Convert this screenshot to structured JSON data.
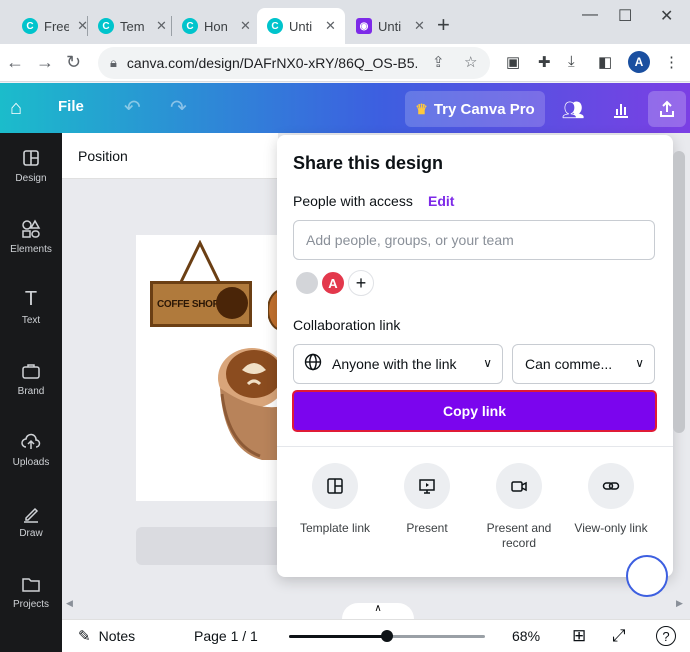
{
  "browser": {
    "tabs": [
      {
        "title": "Free",
        "active": false
      },
      {
        "title": "Tem",
        "active": false
      },
      {
        "title": "Hon",
        "active": false
      },
      {
        "title": "Unti",
        "active": true
      },
      {
        "title": "Unti",
        "active": false
      }
    ],
    "url": "canva.com/design/DAFrNX0-xRY/86Q_OS-B5...",
    "profile_initial": "A"
  },
  "header": {
    "file_label": "File",
    "pro_label": "Try Canva Pro"
  },
  "rail": {
    "items": [
      {
        "label": "Design",
        "icon": "layout-icon"
      },
      {
        "label": "Elements",
        "icon": "shapes-icon"
      },
      {
        "label": "Text",
        "icon": "text-icon"
      },
      {
        "label": "Brand",
        "icon": "brand-icon"
      },
      {
        "label": "Uploads",
        "icon": "upload-icon"
      },
      {
        "label": "Draw",
        "icon": "draw-icon"
      },
      {
        "label": "Projects",
        "icon": "folder-icon"
      }
    ]
  },
  "context": {
    "position_label": "Position"
  },
  "artwork": {
    "sign_text": "COFFE SHOP"
  },
  "share": {
    "title": "Share this design",
    "people_label": "People with access",
    "edit_label": "Edit",
    "input_placeholder": "Add people, groups, or your team",
    "avatar_initial": "A",
    "collab_label": "Collaboration link",
    "access_value": "Anyone with the link",
    "permission_value": "Can comme...",
    "copy_label": "Copy link",
    "options": [
      {
        "label": "Template link",
        "icon": "template-icon"
      },
      {
        "label": "Present",
        "icon": "present-icon"
      },
      {
        "label": "Present and record",
        "icon": "camera-icon"
      },
      {
        "label": "View-only link",
        "icon": "link-icon"
      }
    ]
  },
  "footer": {
    "notes_label": "Notes",
    "page_label": "Page 1 / 1",
    "zoom_label": "68%",
    "zoom_value": 0.5
  },
  "colors": {
    "accent": "#7b05ee",
    "highlight": "#e01a37",
    "rail": "#18191b"
  }
}
